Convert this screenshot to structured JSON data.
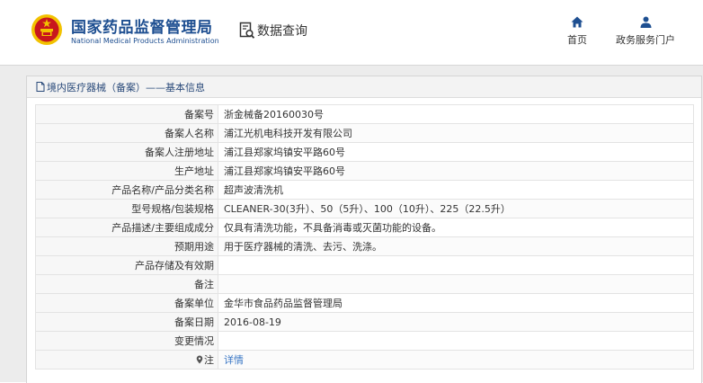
{
  "header": {
    "brand_cn": "国家药品监督管理局",
    "brand_en": "National Medical Products Administration",
    "query_label": "数据查询",
    "nav": [
      {
        "label": "首页",
        "icon": "home-icon"
      },
      {
        "label": "政务服务门户",
        "icon": "user-icon"
      }
    ]
  },
  "panel": {
    "title": "境内医疗器械（备案）——基本信息",
    "rows": [
      {
        "label": "备案号",
        "value": "浙金械备20160030号"
      },
      {
        "label": "备案人名称",
        "value": "浦江光机电科技开发有限公司"
      },
      {
        "label": "备案人注册地址",
        "value": "浦江县郑家坞镇安平路60号"
      },
      {
        "label": "生产地址",
        "value": "浦江县郑家坞镇安平路60号"
      },
      {
        "label": "产品名称/产品分类名称",
        "value": "超声波清洗机"
      },
      {
        "label": "型号规格/包装规格",
        "value": "CLEANER-30(3升）、50（5升）、100（10升）、225（22.5升）"
      },
      {
        "label": "产品描述/主要组成成分",
        "value": "仅具有清洗功能，不具备消毒或灭菌功能的设备。"
      },
      {
        "label": "预期用途",
        "value": "用于医疗器械的清洗、去污、洗涤。"
      },
      {
        "label": "产品存储及有效期",
        "value": ""
      },
      {
        "label": "备注",
        "value": ""
      },
      {
        "label": "备案单位",
        "value": "金华市食品药品监督管理局"
      },
      {
        "label": "备案日期",
        "value": "2016-08-19"
      },
      {
        "label": "变更情况",
        "value": ""
      }
    ],
    "note": {
      "label": "注",
      "link": "详情"
    }
  },
  "colors": {
    "brand": "#1e4f91",
    "link": "#3a77c5",
    "emblem_red": "#c8161d",
    "emblem_gold": "#f2c200"
  }
}
